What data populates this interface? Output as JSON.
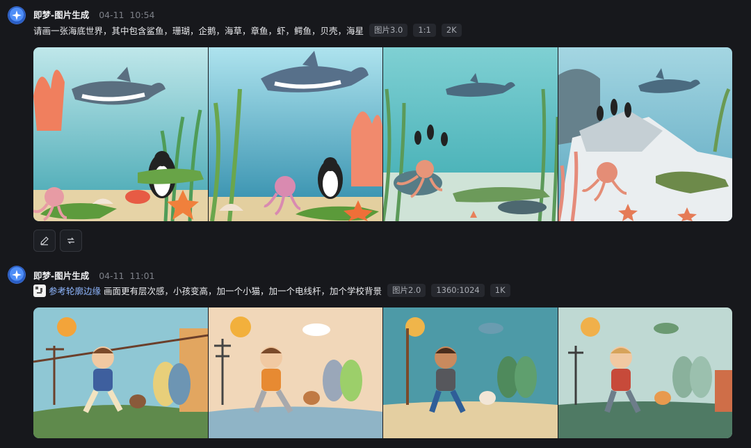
{
  "messages": [
    {
      "app_name": "即梦-图片生成",
      "date": "04-11",
      "time": "10:54",
      "prompt": "请画一张海底世界，其中包含鲨鱼，珊瑚，企鹅，海草，章鱼，虾，鳄鱼，贝壳，海星",
      "tags": [
        "图片3.0",
        "1:1",
        "2K"
      ],
      "images": [
        "underwater-scene-1",
        "underwater-scene-2",
        "underwater-scene-3",
        "underwater-scene-4"
      ],
      "actions": [
        "edit-icon",
        "regenerate-icon"
      ]
    },
    {
      "app_name": "即梦-图片生成",
      "date": "04-11",
      "time": "11:01",
      "reference_label": "参考轮廓边缘",
      "prompt": "画面更有层次感，小孩变高，加一个小猫，加一个电线杆，加个学校背景",
      "tags": [
        "图片2.0",
        "1360:1024",
        "1K"
      ],
      "images": [
        "boy-running-1",
        "boy-running-2",
        "boy-running-3",
        "boy-running-4"
      ]
    }
  ],
  "colors": {
    "background": "#17181c",
    "accent": "#4f8ef7",
    "tag_bg": "#26282e"
  }
}
